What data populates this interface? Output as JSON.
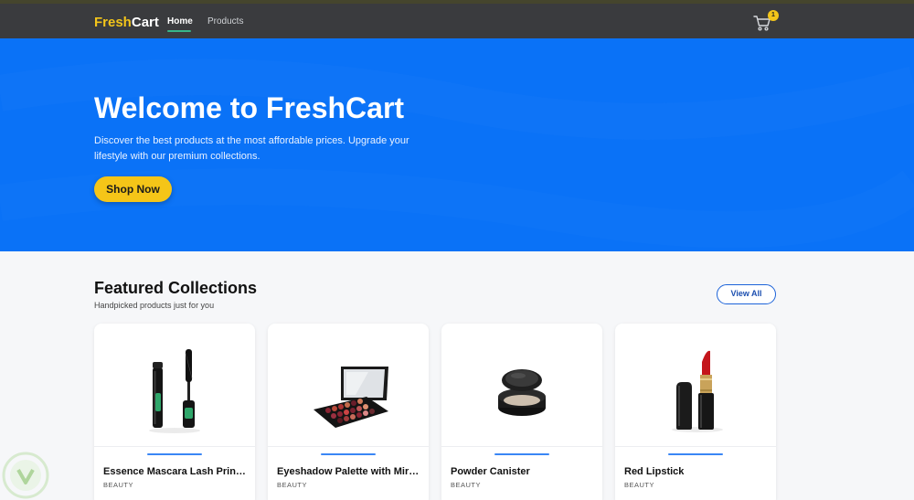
{
  "nav": {
    "brand_fresh": "Fresh",
    "brand_cart": "Cart",
    "links": [
      {
        "label": "Home",
        "active": true
      },
      {
        "label": "Products",
        "active": false
      }
    ],
    "cart_count": "1",
    "cart_icon": "shopping-cart-icon"
  },
  "hero": {
    "title": "Welcome to FreshCart",
    "subtitle": "Discover the best products at the most affordable prices. Upgrade your lifestyle with our premium collections.",
    "cta_label": "Shop Now"
  },
  "featured": {
    "title": "Featured Collections",
    "subtitle": "Handpicked products just for you",
    "view_all_label": "View All",
    "products": [
      {
        "name": "Essence Mascara Lash Princess",
        "category": "BEAUTY",
        "image_icon": "mascara-image"
      },
      {
        "name": "Eyeshadow Palette with Mirror",
        "category": "BEAUTY",
        "image_icon": "eyeshadow-palette-image"
      },
      {
        "name": "Powder Canister",
        "category": "BEAUTY",
        "image_icon": "powder-canister-image"
      },
      {
        "name": "Red Lipstick",
        "category": "BEAUTY",
        "image_icon": "red-lipstick-image"
      }
    ]
  },
  "colors": {
    "brand_yellow": "#f3c51a",
    "hero_blue": "#0a72f7",
    "navbar_dark": "#3a3b3e",
    "accent_blue": "#1c63d9"
  }
}
